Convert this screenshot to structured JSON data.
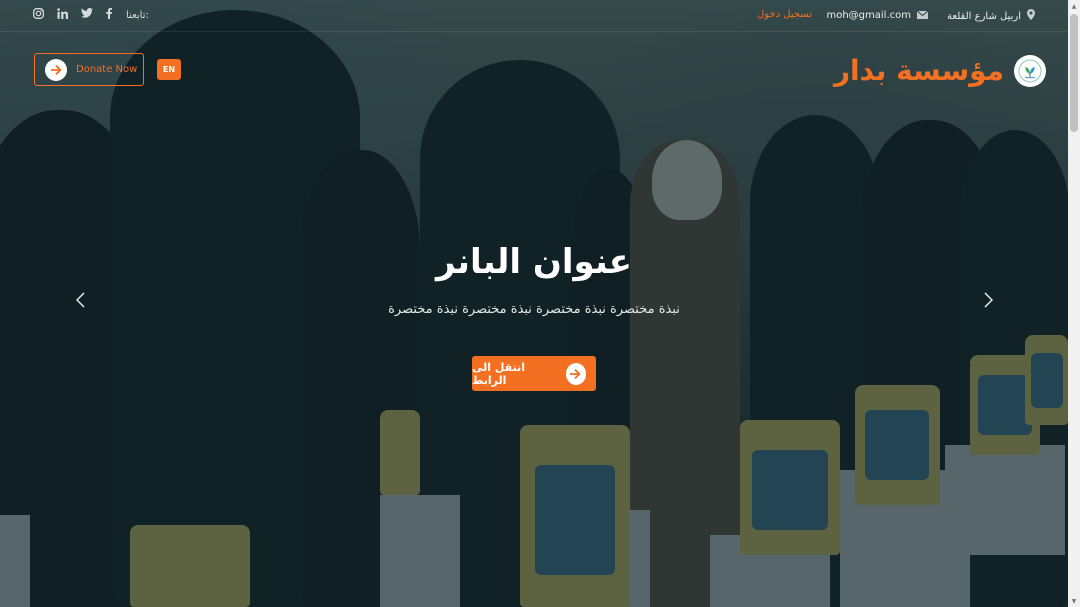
{
  "topbar": {
    "address": "اربيل شارع القلعة",
    "email": "moh@gmail.com",
    "login": "تسجيل دخول",
    "follow_label": "تابعنا:"
  },
  "header": {
    "logo_text": "مؤسسة بدار",
    "donate_label": "Donate Now",
    "lang_label": "EN"
  },
  "hero": {
    "title": "عنوان البانر",
    "subtitle": "نبذة مختصرة نبذة مختصرة نبذة مختصرة نبذة مختصرة",
    "cta_label": "انتقل الى الرابط"
  },
  "icons": [
    "map-marker-icon",
    "envelope-icon",
    "facebook-icon",
    "twitter-icon",
    "linkedin-icon",
    "instagram-icon",
    "arrow-right-icon",
    "chevron-left-icon",
    "chevron-right-icon"
  ],
  "colors": {
    "accent": "#f36f21",
    "overlay": "#10282f"
  }
}
